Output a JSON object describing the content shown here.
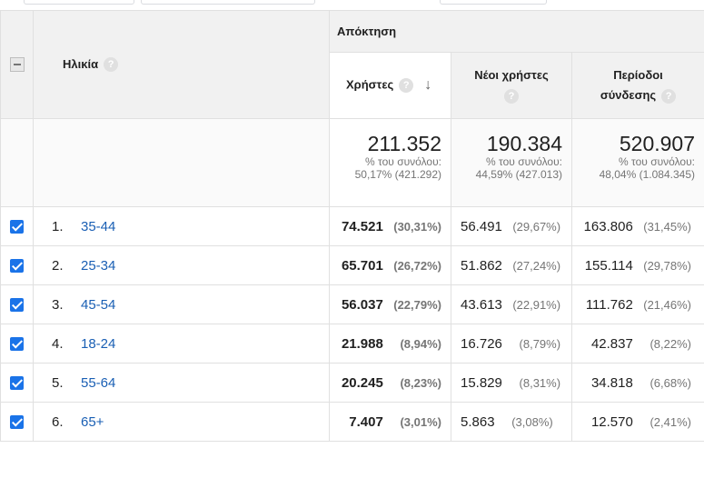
{
  "header": {
    "dimension_label": "Ηλικία",
    "group_label": "Απόκτηση",
    "columns": [
      {
        "label": "Χρήστες"
      },
      {
        "label": "Νέοι χρήστες"
      },
      {
        "label_line1": "Περίοδοι",
        "label_line2": "σύνδεσης"
      }
    ],
    "help_glyph": "?"
  },
  "totals": [
    {
      "value": "211.352",
      "sub1": "% του συνόλου:",
      "sub2": "50,17% (421.292)"
    },
    {
      "value": "190.384",
      "sub1": "% του συνόλου:",
      "sub2": "44,59% (427.013)"
    },
    {
      "value": "520.907",
      "sub1": "% του συνόλου:",
      "sub2": "48,04% (1.084.345)"
    }
  ],
  "rows": [
    {
      "index": "1.",
      "age": "35-44",
      "users": "74.521",
      "users_pct": "(30,31%)",
      "new_users": "56.491",
      "new_users_pct": "(29,67%)",
      "sessions": "163.806",
      "sessions_pct": "(31,45%)"
    },
    {
      "index": "2.",
      "age": "25-34",
      "users": "65.701",
      "users_pct": "(26,72%)",
      "new_users": "51.862",
      "new_users_pct": "(27,24%)",
      "sessions": "155.114",
      "sessions_pct": "(29,78%)"
    },
    {
      "index": "3.",
      "age": "45-54",
      "users": "56.037",
      "users_pct": "(22,79%)",
      "new_users": "43.613",
      "new_users_pct": "(22,91%)",
      "sessions": "111.762",
      "sessions_pct": "(21,46%)"
    },
    {
      "index": "4.",
      "age": "18-24",
      "users": "21.988",
      "users_pct": "(8,94%)",
      "new_users": "16.726",
      "new_users_pct": "(8,79%)",
      "sessions": "42.837",
      "sessions_pct": "(8,22%)"
    },
    {
      "index": "5.",
      "age": "55-64",
      "users": "20.245",
      "users_pct": "(8,23%)",
      "new_users": "15.829",
      "new_users_pct": "(8,31%)",
      "sessions": "34.818",
      "sessions_pct": "(6,68%)"
    },
    {
      "index": "6.",
      "age": "65+",
      "users": "7.407",
      "users_pct": "(3,01%)",
      "new_users": "5.863",
      "new_users_pct": "(3,08%)",
      "sessions": "12.570",
      "sessions_pct": "(2,41%)"
    }
  ],
  "icons": {
    "sort": "arrow-down-icon",
    "checkbox": "checkbox-checked-icon",
    "select_all": "minus-checkbox-icon",
    "help": "help-icon"
  },
  "colors": {
    "header_bg": "#f1f1f1",
    "link": "#1a5fb4",
    "checkbox": "#1a73e8"
  }
}
